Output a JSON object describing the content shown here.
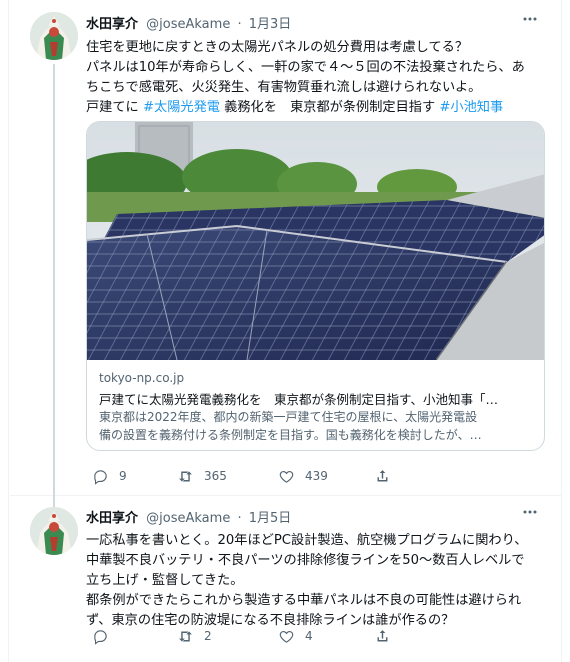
{
  "tweets": [
    {
      "name": "水田享介",
      "handle": "@joseAkame",
      "separator": "·",
      "date": "1月3日",
      "text_lines": [
        [
          {
            "t": "住宅を更地に戻すときの太陽光パネルの処分費用は考慮してる？"
          }
        ],
        [
          {
            "t": "パネルは10年が寿命らしく、一軒の家で４～５回の不法投棄されたら、あ"
          }
        ],
        [
          {
            "t": "ちこちで感電死、火災発生、有害物質垂れ流しは避けられないよ。"
          }
        ],
        [
          {
            "t": "戸建てに "
          },
          {
            "t": "#太陽光発電",
            "tag": true
          },
          {
            "t": " 義務化を　東京都が条例制定目指す "
          },
          {
            "t": "#小池知事",
            "tag": true
          }
        ]
      ],
      "card": {
        "domain": "tokyo-np.co.jp",
        "title": "戸建てに太陽光発電義務化を　東京都が条例制定目指す、小池知事「…",
        "description_lines": [
          "東京都は2022年度、都内の新築一戸建て住宅の屋根に、太陽光発電設",
          "備の設置を義務付ける条例制定を目指す。国も義務化を検討したが、…"
        ]
      },
      "actions": {
        "reply": "9",
        "retweet": "365",
        "like": "439"
      }
    },
    {
      "name": "水田享介",
      "handle": "@joseAkame",
      "separator": "·",
      "date": "1月5日",
      "text_lines": [
        [
          {
            "t": "一応私事を書いとく。20年ほどPC設計製造、航空機プログラムに関わり、"
          }
        ],
        [
          {
            "t": "中華製不良バッテリ・不良パーツの排除修復ラインを50～数百人レベルで"
          }
        ],
        [
          {
            "t": "立ち上げ・監督してきた。"
          }
        ],
        [
          {
            "t": "都条例ができたらこれから製造する中華パネルは不良の可能性は避けられ"
          }
        ],
        [
          {
            "t": "ず、東京の住宅の防波堤になる不良排除ラインは誰が作るの？"
          }
        ]
      ],
      "actions": {
        "reply": "",
        "retweet": "2",
        "like": "4"
      }
    }
  ],
  "icons": {
    "more": "more-icon",
    "reply": "reply-icon",
    "retweet": "retweet-icon",
    "like": "heart-icon",
    "share": "share-icon"
  },
  "colors": {
    "hashtag": "#1d9bf0",
    "secondary": "#536471",
    "border": "#cfd9de"
  }
}
